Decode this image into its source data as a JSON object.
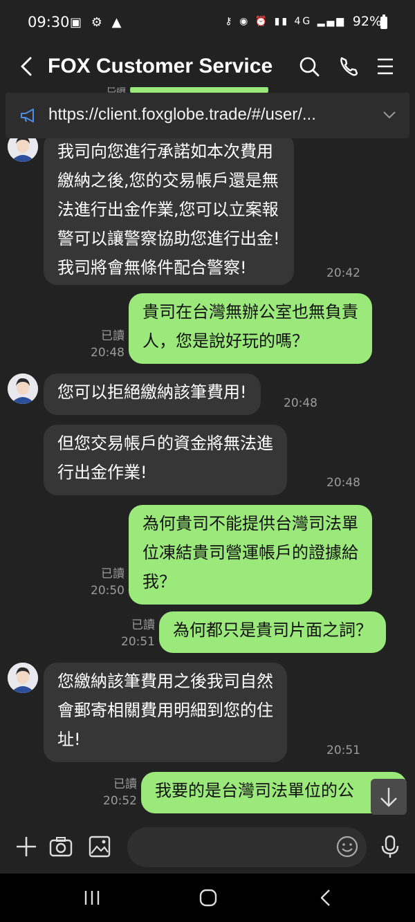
{
  "status_bar": {
    "time": "09:30",
    "battery": "92%",
    "network": "4G"
  },
  "header": {
    "title": "FOX Customer Service"
  },
  "notice": {
    "url": "https://client.foxglobe.trade/#/user/..."
  },
  "messages": [
    {
      "side": "in",
      "lines": [
        "我司向您進行承諾如本次費用",
        "繳納之後,您的交易帳戶還是無",
        "法進行出金作業,您可以立案報",
        "警可以讓警察協助您進行出金!",
        "我司將會無條件配合警察!"
      ],
      "time": "20:42"
    },
    {
      "side": "out",
      "lines": [
        "貴司在台灣無辦公室也無負責",
        "人，您是說好玩的嗎？"
      ],
      "read": "已讀",
      "time": "20:48"
    },
    {
      "side": "in",
      "lines": [
        "您可以拒絕繳納該筆費用!"
      ],
      "time": "20:48"
    },
    {
      "side": "in",
      "lines": [
        "但您交易帳戶的資金將無法進",
        "行出金作業!"
      ],
      "time": "20:48"
    },
    {
      "side": "out",
      "lines": [
        "為何貴司不能提供台灣司法單",
        "位凍結貴司營運帳戶的證據給",
        "我？"
      ],
      "read": "已讀",
      "time": "20:50"
    },
    {
      "side": "out",
      "lines": [
        "為何都只是貴司片面之詞？"
      ],
      "read": "已讀",
      "time": "20:51"
    },
    {
      "side": "in",
      "lines": [
        "您繳納該筆費用之後我司自然",
        "會郵寄相關費用明細到您的住",
        "址!"
      ],
      "time": "20:51"
    },
    {
      "side": "out",
      "lines": [
        "我要的是台灣司法單位的公"
      ],
      "read": "已讀",
      "time": "20:52"
    }
  ],
  "input": {
    "placeholder": ""
  },
  "colors": {
    "background": "#222222",
    "incoming_bubble": "#363636",
    "outgoing_bubble": "#9be97b"
  },
  "icons": [
    "back-arrow-icon",
    "search-icon",
    "phone-icon",
    "menu-icon",
    "megaphone-icon",
    "chevron-down-icon",
    "plus-icon",
    "camera-icon",
    "image-icon",
    "emoji-icon",
    "microphone-icon",
    "arrow-down-icon"
  ]
}
